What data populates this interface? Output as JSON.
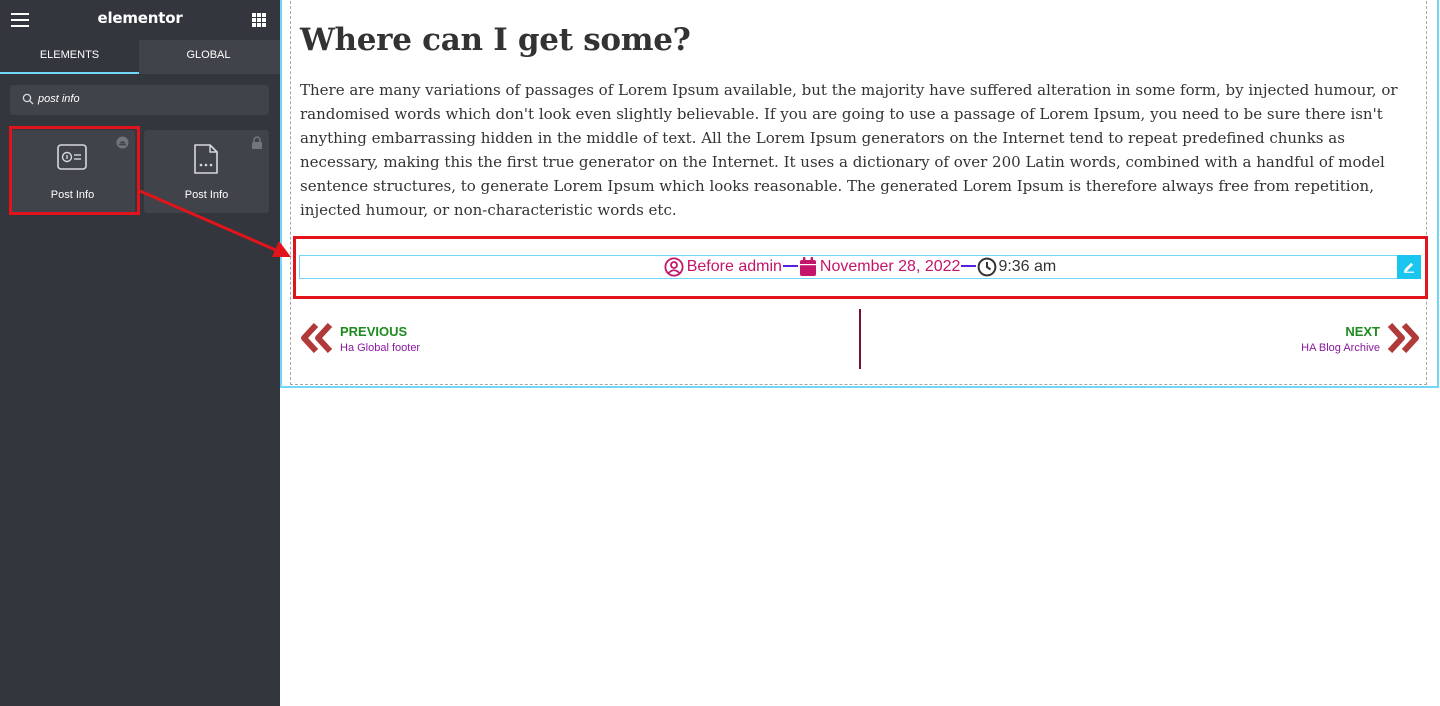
{
  "app": {
    "brand": "elementor"
  },
  "sidebar": {
    "tabs": [
      {
        "label": "ELEMENTS"
      },
      {
        "label": "GLOBAL"
      }
    ],
    "search": {
      "value": "post info"
    },
    "widgets": [
      {
        "label": "Post Info",
        "icon": "post-info-icon",
        "badge": "pro-badge-icon"
      },
      {
        "label": "Post Info",
        "icon": "post-document-icon",
        "badge": "lock-icon"
      }
    ]
  },
  "content": {
    "heading": "Where can I get some?",
    "paragraph": "There are many variations of passages of Lorem Ipsum available, but the majority have suffered alteration in some form, by injected humour, or randomised words which don't look even slightly believable. If you are going to use a passage of Lorem Ipsum, you need to be sure there isn't anything embarrassing hidden in the middle of text. All the Lorem Ipsum generators on the Internet tend to repeat predefined chunks as necessary, making this the first true generator on the Internet. It uses a dictionary of over 200 Latin words, combined with a handful of model sentence structures, to generate Lorem Ipsum which looks reasonable. The generated Lorem Ipsum is therefore always free from repetition, injected humour, or non-characteristic words etc.",
    "post_info": {
      "author": "Before admin",
      "date": "November 28, 2022",
      "time": "9:36 am"
    },
    "post_nav": {
      "prev_label": "PREVIOUS",
      "prev_title": "Ha Global footer",
      "next_label": "NEXT",
      "next_title": "HA Blog Archive"
    }
  },
  "colors": {
    "sidebar_bg": "#33373d",
    "accent_cyan": "#71d7f7",
    "highlight_red": "#e2141b",
    "meta_pink": "#c4156a",
    "separator_purple": "#5a1fe0",
    "nav_green": "#1e8b1e",
    "nav_purple": "#8a1aa0",
    "nav_arrow": "#b03a3a"
  }
}
